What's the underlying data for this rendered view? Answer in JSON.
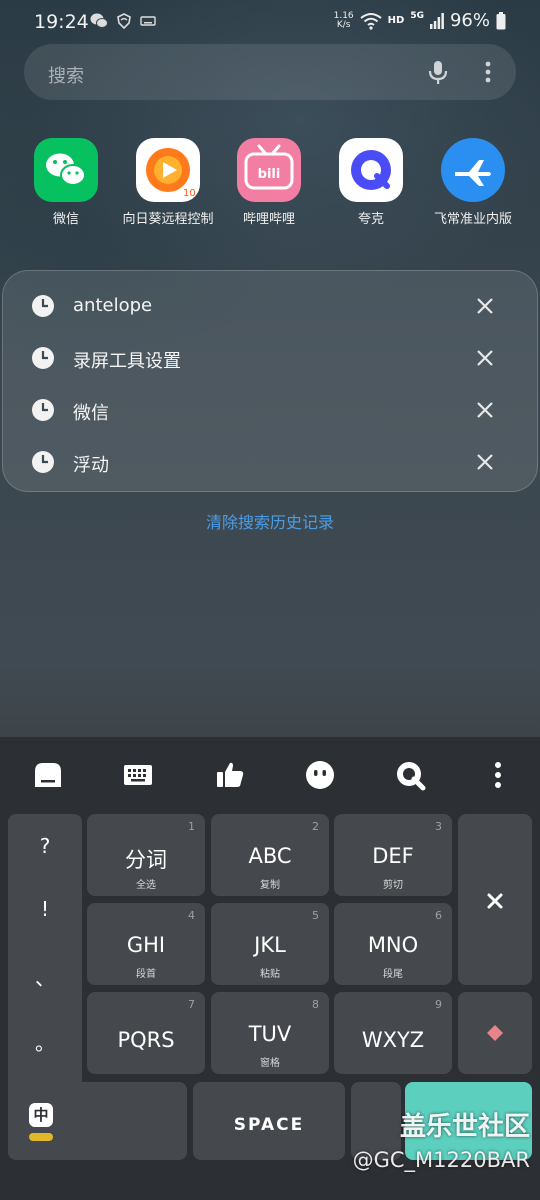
{
  "status_bar": {
    "time": "19:24",
    "net_speed_value": "1.16",
    "net_speed_unit": "K/s",
    "hd": "HD",
    "signal": "5G",
    "battery": "96%"
  },
  "search": {
    "placeholder": "搜索"
  },
  "apps": [
    {
      "label": "微信",
      "color": "#07c160"
    },
    {
      "label": "向日葵远程控制",
      "color": "#ff7a1a"
    },
    {
      "label": "哔哩哔哩",
      "color": "#f27fa3"
    },
    {
      "label": "夸克",
      "color": "#4a4cf5"
    },
    {
      "label": "飞常准业内版",
      "color": "#2a8ff0"
    }
  ],
  "history": {
    "items": [
      "antelope",
      "录屏工具设置",
      "微信",
      "浮动"
    ],
    "clear_label": "清除搜索历史记录"
  },
  "keyboard": {
    "punct": [
      "?",
      "!",
      "、",
      "。"
    ],
    "keys": [
      {
        "num": "1",
        "main": "分词",
        "sub": "全选"
      },
      {
        "num": "2",
        "main": "ABC",
        "sub": "复制"
      },
      {
        "num": "3",
        "main": "DEF",
        "sub": "剪切"
      },
      {
        "num": "4",
        "main": "GHI",
        "sub": "段首"
      },
      {
        "num": "5",
        "main": "JKL",
        "sub": "粘贴"
      },
      {
        "num": "6",
        "main": "MNO",
        "sub": "段尾"
      },
      {
        "num": "7",
        "main": "PQRS",
        "sub": ""
      },
      {
        "num": "8",
        "main": "TUV",
        "sub": "窗格"
      },
      {
        "num": "9",
        "main": "WXYZ",
        "sub": ""
      }
    ],
    "lang_label": "中",
    "space_label": "SPACE",
    "enter_color": "#5ccfbe",
    "accent_color": "#e0b829"
  },
  "watermark": {
    "text": "盖乐世社区",
    "handle": "@GC_M1220BAR"
  }
}
